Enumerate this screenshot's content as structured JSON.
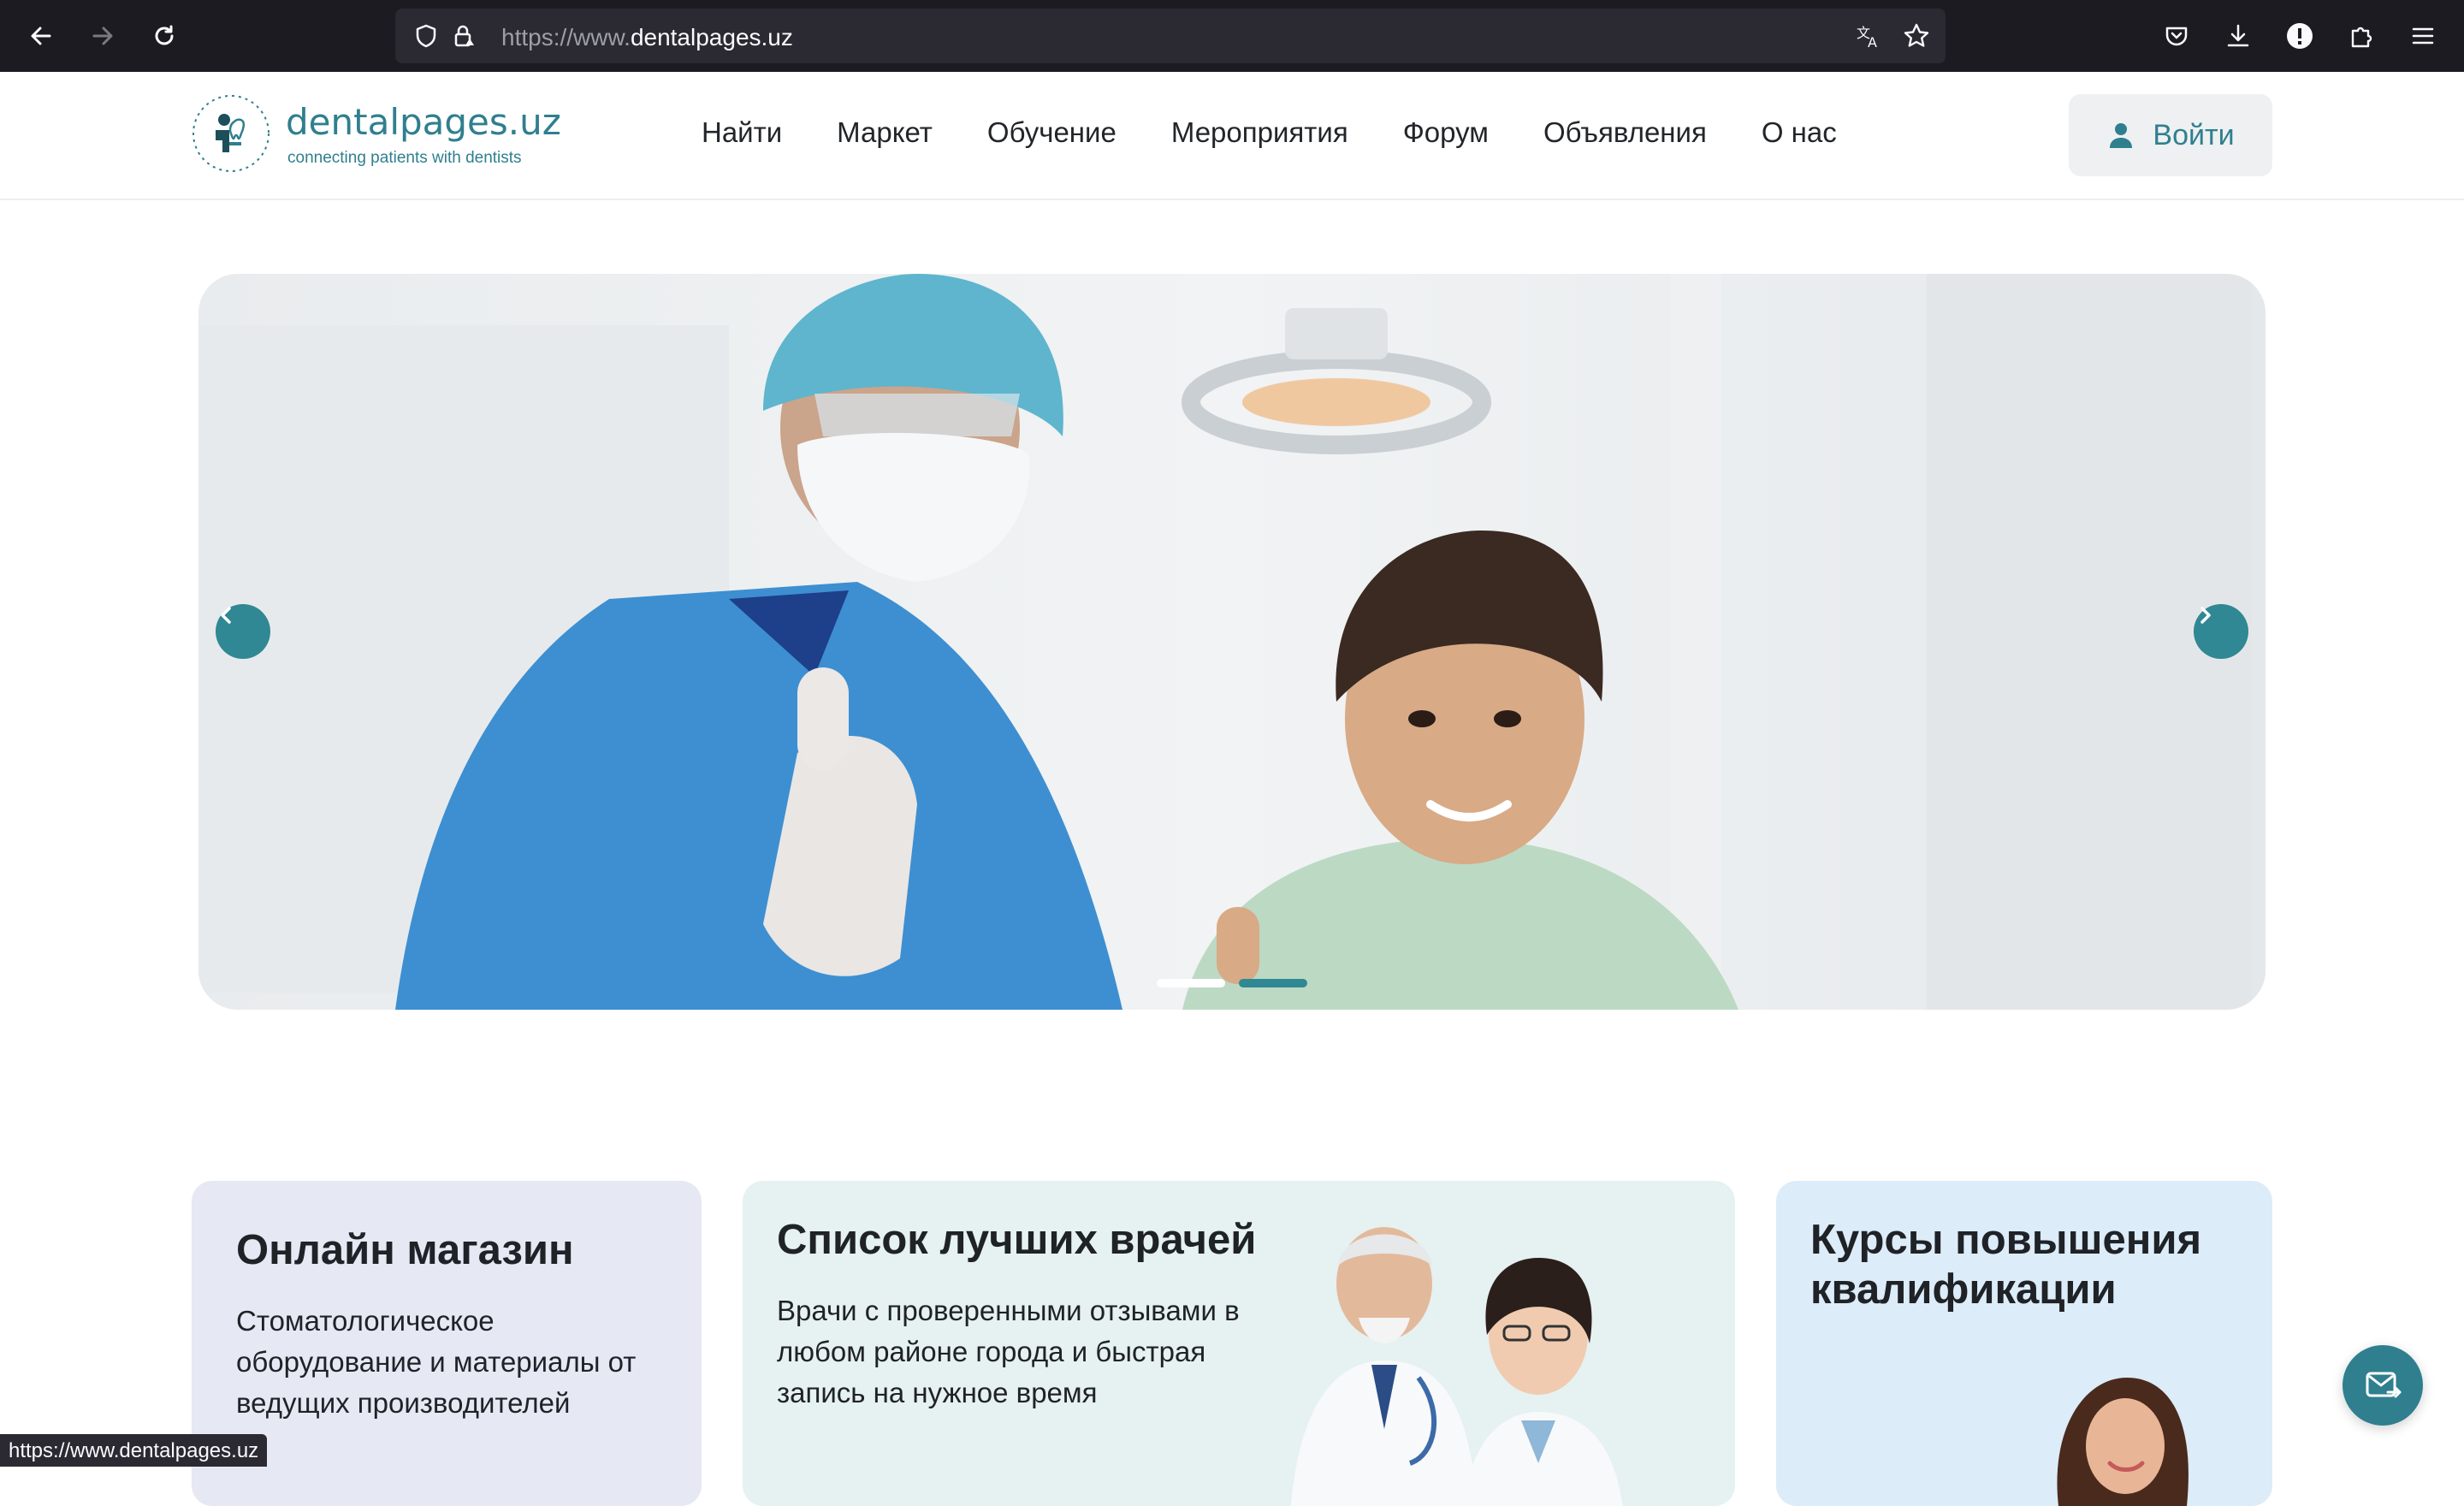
{
  "browser": {
    "url_prefix": "https://www.",
    "url_domain": "dentalpages.uz",
    "status_url": "https://www.dentalpages.uz"
  },
  "header": {
    "logo_name": "dentalpages.uz",
    "logo_tagline": "connecting patients with dentists",
    "nav": [
      "Найти",
      "Маркет",
      "Обучение",
      "Мероприятия",
      "Форум",
      "Объявления",
      "О нас"
    ],
    "login_label": "Войти"
  },
  "hero": {
    "slide_count": 2,
    "active_slide": 2
  },
  "cards": [
    {
      "title": "Онлайн магазин",
      "text": "Стоматологическое оборудование и материалы от ведущих производителей"
    },
    {
      "title": "Список лучших врачей",
      "text": "Врачи с проверенными отзывами в любом районе города и быстрая запись на нужное время"
    },
    {
      "title": "Курсы повышения квалификации",
      "text": ""
    }
  ],
  "colors": {
    "brand": "#2f7f8e",
    "chrome_bg": "#1c1b22",
    "card_shop": "#e6e8f4",
    "card_doctors": "#e6f1f1",
    "card_courses": "#dcecf8"
  }
}
